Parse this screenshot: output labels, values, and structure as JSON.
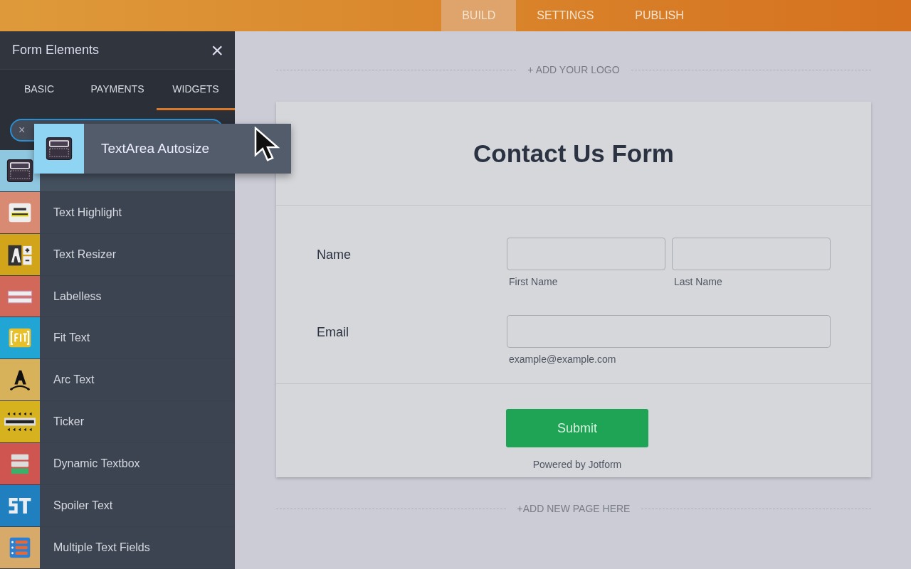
{
  "top_tabs": [
    {
      "label": "BUILD",
      "selected": true
    },
    {
      "label": "SETTINGS",
      "selected": false
    },
    {
      "label": "PUBLISH",
      "selected": false
    }
  ],
  "panel": {
    "title": "Form Elements",
    "close": "×",
    "tabs": [
      {
        "label": "BASIC",
        "selected": false
      },
      {
        "label": "PAYMENTS",
        "selected": false
      },
      {
        "label": "WIDGETS",
        "selected": true
      }
    ],
    "search": {
      "clear": "×"
    },
    "items": [
      {
        "kind": "textarea",
        "color": "#8fc7e0",
        "selected": true
      },
      {
        "label": "Text Highlight",
        "kind": "highlight",
        "color": "#d98a72",
        "selected": false
      },
      {
        "label": "Text Resizer",
        "kind": "resizer",
        "color": "#d2a419",
        "selected": false
      },
      {
        "label": "Labelless",
        "kind": "labelless",
        "color": "#d2685a",
        "selected": false
      },
      {
        "label": "Fit Text",
        "kind": "fit",
        "color": "#20a5d4",
        "selected": false
      },
      {
        "label": "Arc Text",
        "kind": "arc",
        "color": "#d8b25a",
        "selected": false
      },
      {
        "label": "Ticker",
        "kind": "ticker",
        "color": "#d6b21f",
        "selected": false
      },
      {
        "label": "Dynamic Textbox",
        "kind": "dynamic",
        "color": "#cf5550",
        "selected": false
      },
      {
        "label": "Spoiler Text",
        "kind": "spoiler",
        "color": "#1f7fbf",
        "selected": false
      },
      {
        "label": "Multiple Text Fields",
        "kind": "multi",
        "color": "#d8aa6a",
        "selected": false
      }
    ],
    "dragged": {
      "label": "TextArea Autosize",
      "kind": "textarea"
    }
  },
  "form": {
    "logo": "+ ADD YOUR LOGO",
    "title": "Contact Us Form",
    "name": {
      "label": "Name",
      "first": "First Name",
      "last": "Last Name"
    },
    "email": {
      "label": "Email",
      "hint": "example@example.com"
    },
    "submit": "Submit",
    "powered": "Powered by Jotform",
    "add_page": "+ADD NEW PAGE HERE"
  }
}
